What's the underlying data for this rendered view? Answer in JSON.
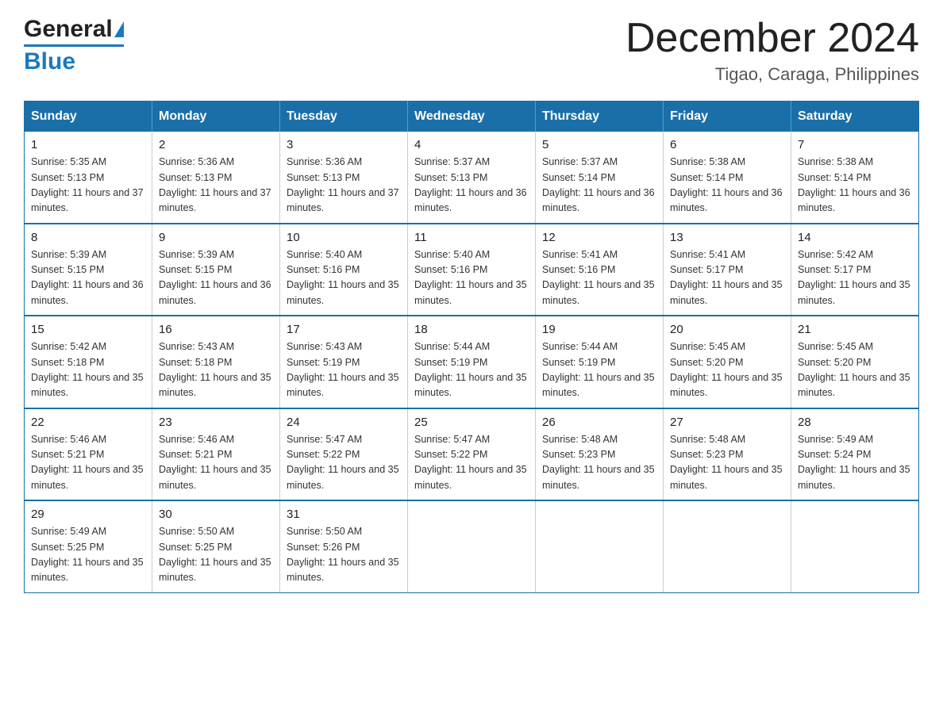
{
  "header": {
    "logo_general": "General",
    "logo_triangle": "▶",
    "logo_blue": "Blue",
    "main_title": "December 2024",
    "subtitle": "Tigao, Caraga, Philippines"
  },
  "calendar": {
    "days_of_week": [
      "Sunday",
      "Monday",
      "Tuesday",
      "Wednesday",
      "Thursday",
      "Friday",
      "Saturday"
    ],
    "weeks": [
      [
        {
          "day": "1",
          "sunrise": "Sunrise: 5:35 AM",
          "sunset": "Sunset: 5:13 PM",
          "daylight": "Daylight: 11 hours and 37 minutes."
        },
        {
          "day": "2",
          "sunrise": "Sunrise: 5:36 AM",
          "sunset": "Sunset: 5:13 PM",
          "daylight": "Daylight: 11 hours and 37 minutes."
        },
        {
          "day": "3",
          "sunrise": "Sunrise: 5:36 AM",
          "sunset": "Sunset: 5:13 PM",
          "daylight": "Daylight: 11 hours and 37 minutes."
        },
        {
          "day": "4",
          "sunrise": "Sunrise: 5:37 AM",
          "sunset": "Sunset: 5:13 PM",
          "daylight": "Daylight: 11 hours and 36 minutes."
        },
        {
          "day": "5",
          "sunrise": "Sunrise: 5:37 AM",
          "sunset": "Sunset: 5:14 PM",
          "daylight": "Daylight: 11 hours and 36 minutes."
        },
        {
          "day": "6",
          "sunrise": "Sunrise: 5:38 AM",
          "sunset": "Sunset: 5:14 PM",
          "daylight": "Daylight: 11 hours and 36 minutes."
        },
        {
          "day": "7",
          "sunrise": "Sunrise: 5:38 AM",
          "sunset": "Sunset: 5:14 PM",
          "daylight": "Daylight: 11 hours and 36 minutes."
        }
      ],
      [
        {
          "day": "8",
          "sunrise": "Sunrise: 5:39 AM",
          "sunset": "Sunset: 5:15 PM",
          "daylight": "Daylight: 11 hours and 36 minutes."
        },
        {
          "day": "9",
          "sunrise": "Sunrise: 5:39 AM",
          "sunset": "Sunset: 5:15 PM",
          "daylight": "Daylight: 11 hours and 36 minutes."
        },
        {
          "day": "10",
          "sunrise": "Sunrise: 5:40 AM",
          "sunset": "Sunset: 5:16 PM",
          "daylight": "Daylight: 11 hours and 35 minutes."
        },
        {
          "day": "11",
          "sunrise": "Sunrise: 5:40 AM",
          "sunset": "Sunset: 5:16 PM",
          "daylight": "Daylight: 11 hours and 35 minutes."
        },
        {
          "day": "12",
          "sunrise": "Sunrise: 5:41 AM",
          "sunset": "Sunset: 5:16 PM",
          "daylight": "Daylight: 11 hours and 35 minutes."
        },
        {
          "day": "13",
          "sunrise": "Sunrise: 5:41 AM",
          "sunset": "Sunset: 5:17 PM",
          "daylight": "Daylight: 11 hours and 35 minutes."
        },
        {
          "day": "14",
          "sunrise": "Sunrise: 5:42 AM",
          "sunset": "Sunset: 5:17 PM",
          "daylight": "Daylight: 11 hours and 35 minutes."
        }
      ],
      [
        {
          "day": "15",
          "sunrise": "Sunrise: 5:42 AM",
          "sunset": "Sunset: 5:18 PM",
          "daylight": "Daylight: 11 hours and 35 minutes."
        },
        {
          "day": "16",
          "sunrise": "Sunrise: 5:43 AM",
          "sunset": "Sunset: 5:18 PM",
          "daylight": "Daylight: 11 hours and 35 minutes."
        },
        {
          "day": "17",
          "sunrise": "Sunrise: 5:43 AM",
          "sunset": "Sunset: 5:19 PM",
          "daylight": "Daylight: 11 hours and 35 minutes."
        },
        {
          "day": "18",
          "sunrise": "Sunrise: 5:44 AM",
          "sunset": "Sunset: 5:19 PM",
          "daylight": "Daylight: 11 hours and 35 minutes."
        },
        {
          "day": "19",
          "sunrise": "Sunrise: 5:44 AM",
          "sunset": "Sunset: 5:19 PM",
          "daylight": "Daylight: 11 hours and 35 minutes."
        },
        {
          "day": "20",
          "sunrise": "Sunrise: 5:45 AM",
          "sunset": "Sunset: 5:20 PM",
          "daylight": "Daylight: 11 hours and 35 minutes."
        },
        {
          "day": "21",
          "sunrise": "Sunrise: 5:45 AM",
          "sunset": "Sunset: 5:20 PM",
          "daylight": "Daylight: 11 hours and 35 minutes."
        }
      ],
      [
        {
          "day": "22",
          "sunrise": "Sunrise: 5:46 AM",
          "sunset": "Sunset: 5:21 PM",
          "daylight": "Daylight: 11 hours and 35 minutes."
        },
        {
          "day": "23",
          "sunrise": "Sunrise: 5:46 AM",
          "sunset": "Sunset: 5:21 PM",
          "daylight": "Daylight: 11 hours and 35 minutes."
        },
        {
          "day": "24",
          "sunrise": "Sunrise: 5:47 AM",
          "sunset": "Sunset: 5:22 PM",
          "daylight": "Daylight: 11 hours and 35 minutes."
        },
        {
          "day": "25",
          "sunrise": "Sunrise: 5:47 AM",
          "sunset": "Sunset: 5:22 PM",
          "daylight": "Daylight: 11 hours and 35 minutes."
        },
        {
          "day": "26",
          "sunrise": "Sunrise: 5:48 AM",
          "sunset": "Sunset: 5:23 PM",
          "daylight": "Daylight: 11 hours and 35 minutes."
        },
        {
          "day": "27",
          "sunrise": "Sunrise: 5:48 AM",
          "sunset": "Sunset: 5:23 PM",
          "daylight": "Daylight: 11 hours and 35 minutes."
        },
        {
          "day": "28",
          "sunrise": "Sunrise: 5:49 AM",
          "sunset": "Sunset: 5:24 PM",
          "daylight": "Daylight: 11 hours and 35 minutes."
        }
      ],
      [
        {
          "day": "29",
          "sunrise": "Sunrise: 5:49 AM",
          "sunset": "Sunset: 5:25 PM",
          "daylight": "Daylight: 11 hours and 35 minutes."
        },
        {
          "day": "30",
          "sunrise": "Sunrise: 5:50 AM",
          "sunset": "Sunset: 5:25 PM",
          "daylight": "Daylight: 11 hours and 35 minutes."
        },
        {
          "day": "31",
          "sunrise": "Sunrise: 5:50 AM",
          "sunset": "Sunset: 5:26 PM",
          "daylight": "Daylight: 11 hours and 35 minutes."
        },
        null,
        null,
        null,
        null
      ]
    ]
  }
}
